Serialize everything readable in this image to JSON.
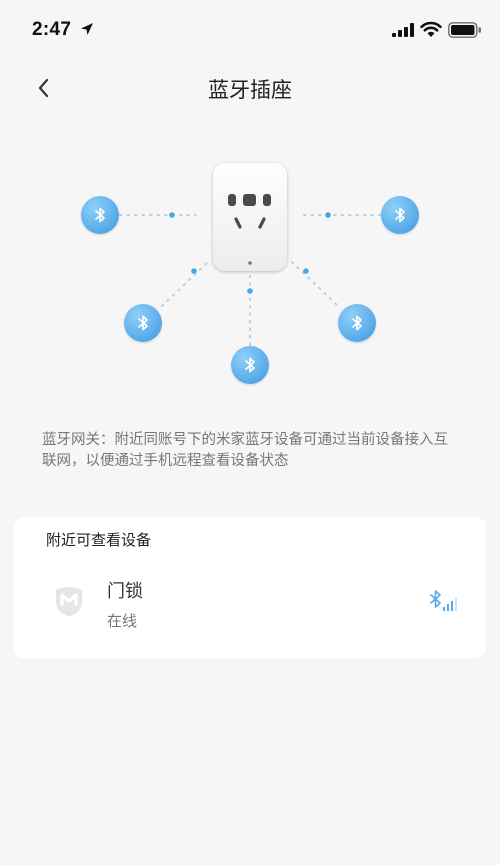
{
  "status_bar": {
    "time": "2:47",
    "icons": [
      "location-arrow-icon",
      "cellular-signal-icon",
      "wifi-icon",
      "battery-icon"
    ]
  },
  "nav": {
    "back_icon": "chevron-left-icon",
    "title": "蓝牙插座"
  },
  "diagram": {
    "center_icon": "smart-socket-icon",
    "node_icon": "bluetooth-icon",
    "node_count": 5,
    "node_color": "#3b98e3"
  },
  "description": "蓝牙网关：附近同账号下的米家蓝牙设备可通过当前设备接入互联网，以便通过手机远程查看设备状态",
  "nearby": {
    "title": "附近可查看设备",
    "devices": [
      {
        "icon": "mijia-logo-icon",
        "name": "门锁",
        "status": "在线",
        "signal_icon": "bluetooth-signal-icon"
      }
    ]
  }
}
